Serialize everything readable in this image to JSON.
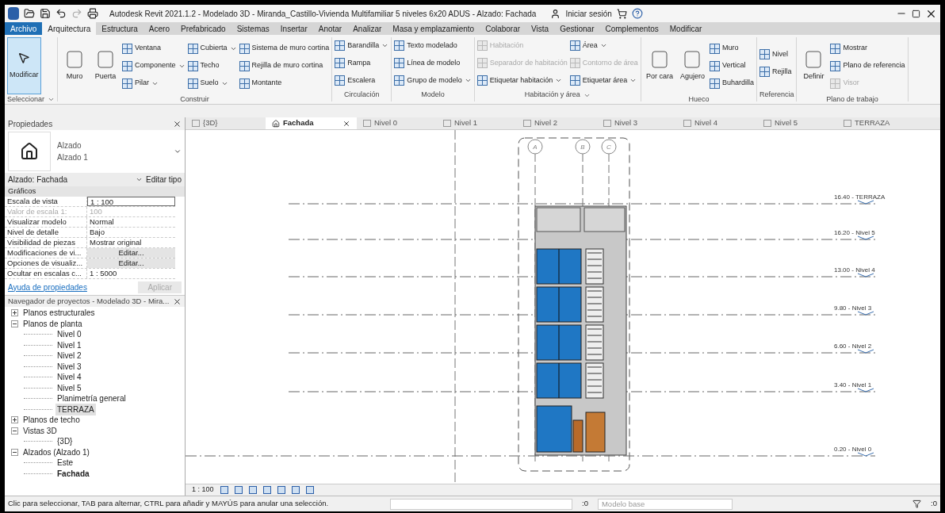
{
  "title_bar": {
    "title": "Autodesk Revit 2021.1.2 - Modelado 3D - Miranda_Castillo-Vivienda Multifamiliar 5 niveles 6x20 ADUS - Alzado: Fachada",
    "sign_in": "Iniciar sesión"
  },
  "file_menu": "Archivo",
  "menu_tabs": [
    {
      "label": "Arquitectura",
      "selected": true
    },
    {
      "label": "Estructura",
      "selected": false
    },
    {
      "label": "Acero",
      "selected": false
    },
    {
      "label": "Prefabricado",
      "selected": false
    },
    {
      "label": "Sistemas",
      "selected": false
    },
    {
      "label": "Insertar",
      "selected": false
    },
    {
      "label": "Anotar",
      "selected": false
    },
    {
      "label": "Analizar",
      "selected": false
    },
    {
      "label": "Masa y emplazamiento",
      "selected": false
    },
    {
      "label": "Colaborar",
      "selected": false
    },
    {
      "label": "Vista",
      "selected": false
    },
    {
      "label": "Gestionar",
      "selected": false
    },
    {
      "label": "Complementos",
      "selected": false
    },
    {
      "label": "Modificar",
      "selected": false
    }
  ],
  "ribbon": [
    {
      "label": "Seleccionar",
      "menu": true,
      "columns": [
        {
          "kind": "large",
          "label": "Modificar",
          "selected": true
        }
      ]
    },
    {
      "label": "Construir",
      "menu": false,
      "columns": [
        {
          "kind": "large",
          "label": "Muro",
          "selected": false
        },
        {
          "kind": "large",
          "label": "Puerta",
          "selected": false
        },
        {
          "kind": "stack",
          "items": [
            {
              "label": "Ventana",
              "disabled": false,
              "dropdown": false
            },
            {
              "label": "Componente",
              "disabled": false,
              "dropdown": true
            },
            {
              "label": "Pilar",
              "disabled": false,
              "dropdown": true
            }
          ]
        },
        {
          "kind": "stack",
          "items": [
            {
              "label": "Cubierta",
              "disabled": false,
              "dropdown": true
            },
            {
              "label": "Techo",
              "disabled": false,
              "dropdown": false
            },
            {
              "label": "Suelo",
              "disabled": false,
              "dropdown": true
            }
          ]
        },
        {
          "kind": "stack",
          "items": [
            {
              "label": "Sistema de muro cortina",
              "disabled": false,
              "dropdown": false
            },
            {
              "label": "Rejilla de muro cortina",
              "disabled": false,
              "dropdown": false
            },
            {
              "label": "Montante",
              "disabled": false,
              "dropdown": false
            }
          ]
        }
      ]
    },
    {
      "label": "Circulación",
      "menu": false,
      "columns": [
        {
          "kind": "stack",
          "items": [
            {
              "label": "Barandilla",
              "disabled": false,
              "dropdown": true
            },
            {
              "label": "Rampa",
              "disabled": false,
              "dropdown": false
            },
            {
              "label": "Escalera",
              "disabled": false,
              "dropdown": false
            }
          ]
        }
      ]
    },
    {
      "label": "Modelo",
      "menu": false,
      "columns": [
        {
          "kind": "stack",
          "items": [
            {
              "label": "Texto modelado",
              "disabled": false,
              "dropdown": false
            },
            {
              "label": "Línea de modelo",
              "disabled": false,
              "dropdown": false
            },
            {
              "label": "Grupo de modelo",
              "disabled": false,
              "dropdown": true
            }
          ]
        }
      ]
    },
    {
      "label": "Habitación y área",
      "menu": true,
      "columns": [
        {
          "kind": "stack",
          "items": [
            {
              "label": "Habitación",
              "disabled": true,
              "dropdown": false
            },
            {
              "label": "Separador de habitación",
              "disabled": true,
              "dropdown": false
            },
            {
              "label": "Etiquetar habitación",
              "disabled": false,
              "dropdown": true
            }
          ]
        },
        {
          "kind": "stack",
          "items": [
            {
              "label": "Área",
              "disabled": false,
              "dropdown": true
            },
            {
              "label": "Contorno de área",
              "disabled": true,
              "dropdown": false
            },
            {
              "label": "Etiquetar área",
              "disabled": false,
              "dropdown": true
            }
          ]
        }
      ]
    },
    {
      "label": "Hueco",
      "menu": false,
      "columns": [
        {
          "kind": "large",
          "label": "Por cara",
          "selected": false
        },
        {
          "kind": "large",
          "label": "Agujero",
          "selected": false
        },
        {
          "kind": "stack",
          "items": [
            {
              "label": "Muro",
              "disabled": false,
              "dropdown": false
            },
            {
              "label": "Vertical",
              "disabled": false,
              "dropdown": false
            },
            {
              "label": "Buhardilla",
              "disabled": false,
              "dropdown": false
            }
          ]
        }
      ]
    },
    {
      "label": "Referencia",
      "menu": false,
      "columns": [
        {
          "kind": "stack",
          "items": [
            {
              "label": "Nivel",
              "disabled": false,
              "dropdown": false
            },
            {
              "label": "Rejilla",
              "disabled": false,
              "dropdown": false
            }
          ]
        }
      ]
    },
    {
      "label": "Plano de trabajo",
      "menu": false,
      "columns": [
        {
          "kind": "large",
          "label": "Definir",
          "selected": false
        },
        {
          "kind": "stack",
          "items": [
            {
              "label": "Mostrar",
              "disabled": false,
              "dropdown": false
            },
            {
              "label": "Plano de referencia",
              "disabled": false,
              "dropdown": false
            },
            {
              "label": "Visor",
              "disabled": true,
              "dropdown": false
            }
          ]
        }
      ]
    }
  ],
  "properties": {
    "title": "Propiedades",
    "type_family": "Alzado",
    "type_name": "Alzado 1",
    "selector": "Alzado: Fachada",
    "edit_type": "Editar tipo",
    "section": "Gráficos",
    "rows": [
      {
        "name": "Escala de vista",
        "value": "1 : 100",
        "kind": "input"
      },
      {
        "name": "Valor de escala    1:",
        "value": "100",
        "kind": "readonly"
      },
      {
        "name": "Visualizar modelo",
        "value": "Normal",
        "kind": "text"
      },
      {
        "name": "Nivel de detalle",
        "value": "Bajo",
        "kind": "text"
      },
      {
        "name": "Visibilidad de piezas",
        "value": "Mostrar original",
        "kind": "text"
      },
      {
        "name": "Modificaciones de vi...",
        "value": "Editar...",
        "kind": "button"
      },
      {
        "name": "Opciones de visualiz...",
        "value": "Editar...",
        "kind": "button"
      },
      {
        "name": "Ocultar en escalas c...",
        "value": "1 : 5000",
        "kind": "text"
      }
    ],
    "help_link": "Ayuda de propiedades",
    "apply": "Aplicar"
  },
  "browser": {
    "title": "Navegador de proyectos - Modelado 3D - Mira...",
    "tree": [
      {
        "label": "Planos estructurales",
        "expanded": false,
        "selected": false,
        "bold": false
      },
      {
        "label": "Planos de planta",
        "expanded": true,
        "selected": false,
        "bold": false,
        "children": [
          {
            "label": "Nivel 0",
            "selected": false,
            "bold": false
          },
          {
            "label": "Nivel 1",
            "selected": false,
            "bold": false
          },
          {
            "label": "Nivel 2",
            "selected": false,
            "bold": false
          },
          {
            "label": "Nivel 3",
            "selected": false,
            "bold": false
          },
          {
            "label": "Nivel 4",
            "selected": false,
            "bold": false
          },
          {
            "label": "Nivel 5",
            "selected": false,
            "bold": false
          },
          {
            "label": "Planimetría general",
            "selected": false,
            "bold": false
          },
          {
            "label": "TERRAZA",
            "selected": true,
            "bold": false
          }
        ]
      },
      {
        "label": "Planos de techo",
        "expanded": false,
        "selected": false,
        "bold": false
      },
      {
        "label": "Vistas 3D",
        "expanded": true,
        "selected": false,
        "bold": false,
        "children": [
          {
            "label": "{3D}",
            "selected": false,
            "bold": false
          }
        ]
      },
      {
        "label": "Alzados (Alzado 1)",
        "expanded": true,
        "selected": false,
        "bold": false,
        "children": [
          {
            "label": "Este",
            "selected": false,
            "bold": false
          },
          {
            "label": "Fachada",
            "selected": false,
            "bold": true
          }
        ]
      }
    ]
  },
  "view_tabs": [
    {
      "label": "{3D}",
      "kind": "model",
      "selected": false
    },
    {
      "label": "Fachada",
      "kind": "elevation",
      "selected": true
    },
    {
      "label": "Nivel 0",
      "kind": "plan",
      "selected": false
    },
    {
      "label": "Nivel 1",
      "kind": "plan",
      "selected": false
    },
    {
      "label": "Nivel 2",
      "kind": "plan",
      "selected": false
    },
    {
      "label": "Nivel 3",
      "kind": "plan",
      "selected": false
    },
    {
      "label": "Nivel 4",
      "kind": "plan",
      "selected": false
    },
    {
      "label": "Nivel 5",
      "kind": "plan",
      "selected": false
    },
    {
      "label": "TERRAZA",
      "kind": "plan",
      "selected": false
    }
  ],
  "elevation": {
    "grids": [
      "A",
      "B",
      "C"
    ],
    "levels": [
      {
        "label": "16.40 - TERRAZA"
      },
      {
        "label": "16.20 - Nivel 5"
      },
      {
        "label": "13.00 - Nivel 4"
      },
      {
        "label": "9.80 - Nivel 3"
      },
      {
        "label": "6.60 - Nivel 2"
      },
      {
        "label": "3.40 - Nivel 1"
      },
      {
        "label": "0.20 - Nivel 0"
      }
    ]
  },
  "view_bar": {
    "scale": "1 : 100"
  },
  "status_bar": {
    "message": "Clic para seleccionar, TAB para alternar, CTRL para añadir y MAYÚS para anular una selección.",
    "count": ":0",
    "model": "Modelo base",
    "filter_count": ":0"
  }
}
